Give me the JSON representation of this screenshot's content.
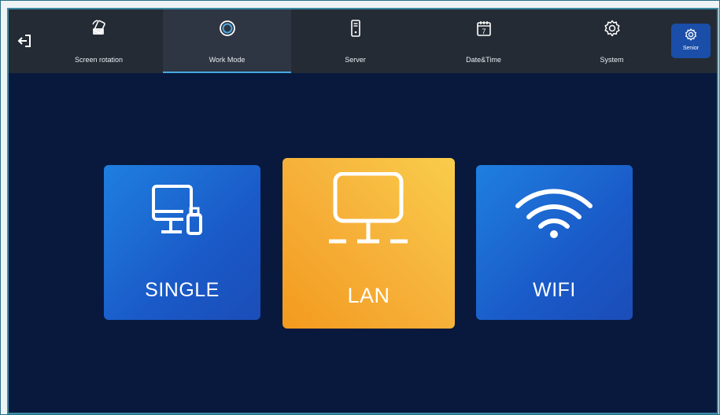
{
  "tabs": [
    {
      "label": "Screen rotation",
      "icon": "screen-rotation-icon"
    },
    {
      "label": "Work Mode",
      "icon": "work-mode-icon",
      "active": true
    },
    {
      "label": "Server",
      "icon": "server-icon"
    },
    {
      "label": "Date&Time",
      "icon": "calendar-icon",
      "calendar_day": "7"
    },
    {
      "label": "System",
      "icon": "gear-icon"
    }
  ],
  "senior": {
    "label": "Senior",
    "icon": "gear-icon"
  },
  "modes": [
    {
      "label": "SINGLE",
      "icon": "monitor-usb-icon"
    },
    {
      "label": "LAN",
      "icon": "monitor-network-icon",
      "selected": true
    },
    {
      "label": "WIFI",
      "icon": "wifi-icon"
    }
  ],
  "colors": {
    "background": "#08193d",
    "topbar": "#252b35",
    "accent": "#4aa8e0",
    "selected_card": "#f6b13a",
    "card": "#1a5ac8"
  }
}
